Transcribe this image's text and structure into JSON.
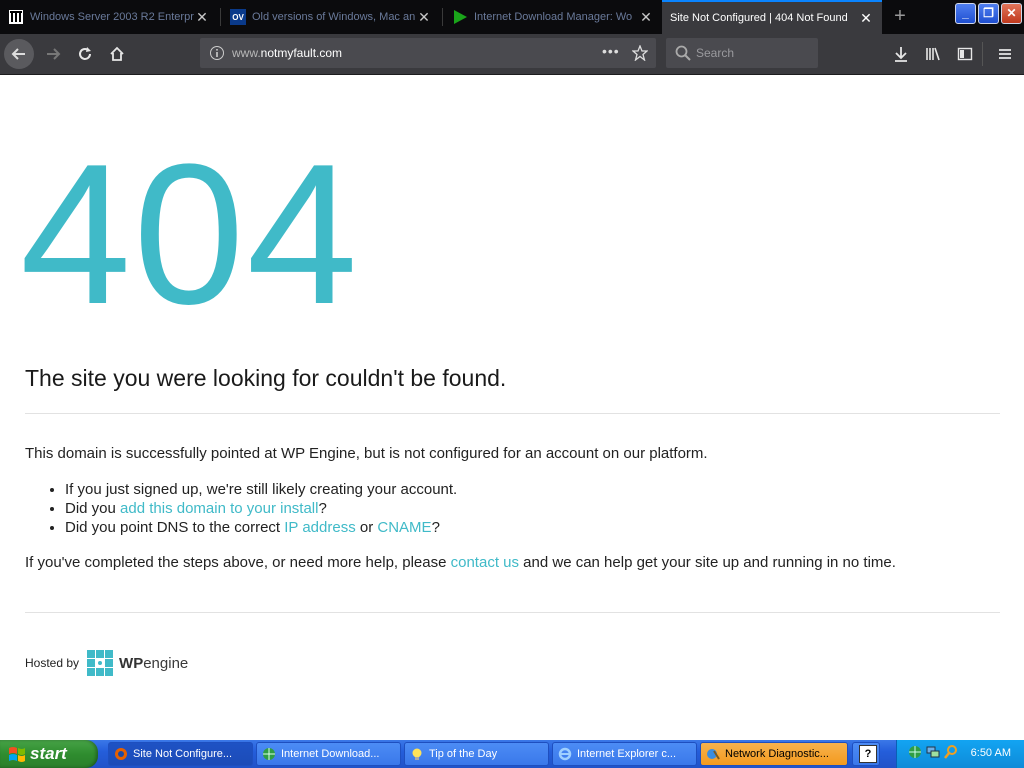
{
  "browser": {
    "tabs": [
      {
        "title": "Windows Server 2003 R2 Enterprise",
        "icon": "library-icon",
        "active": false
      },
      {
        "title": "Old versions of Windows, Mac an",
        "icon": "ov-icon",
        "active": false,
        "icon_text": "OV"
      },
      {
        "title": "Internet Download Manager: Wo",
        "icon": "play-icon",
        "active": false
      },
      {
        "title": "Site Not Configured | 404 Not Found",
        "icon": "none",
        "active": true
      }
    ],
    "url_prefix": "www.",
    "url_domain": "notmyfault.com",
    "search_placeholder": "Search"
  },
  "page": {
    "big_code": "404",
    "heading": "The site you were looking for couldn't be found.",
    "intro": "This domain is successfully pointed at WP Engine, but is not configured for an account on our platform.",
    "bullet1": "If you just signed up, we're still likely creating your account.",
    "bullet2_pre": "Did you ",
    "bullet2_link": "add this domain to your install",
    "bullet2_post": "?",
    "bullet3_pre": "Did you point DNS to the correct ",
    "bullet3_link1": "IP address",
    "bullet3_mid": " or ",
    "bullet3_link2": "CNAME",
    "bullet3_post": "?",
    "help_pre": "If you've completed the steps above, or need more help, please ",
    "help_link": "contact us",
    "help_post": " and we can help get your site up and running in no time.",
    "hosted_by": "Hosted by",
    "wp_brand_bold": "WP",
    "wp_brand_rest": "engine"
  },
  "taskbar": {
    "start_label": "start",
    "tasks": [
      {
        "label": "Site Not Configure...",
        "state": "active"
      },
      {
        "label": "Internet Download...",
        "state": "normal"
      },
      {
        "label": "Tip of the Day",
        "state": "normal"
      },
      {
        "label": "Internet Explorer c...",
        "state": "normal"
      },
      {
        "label": "Network Diagnostic...",
        "state": "flash"
      }
    ],
    "clock": "6:50 AM"
  },
  "colors": {
    "accent": "#40bac8",
    "tab_highlight": "#0a84ff"
  }
}
